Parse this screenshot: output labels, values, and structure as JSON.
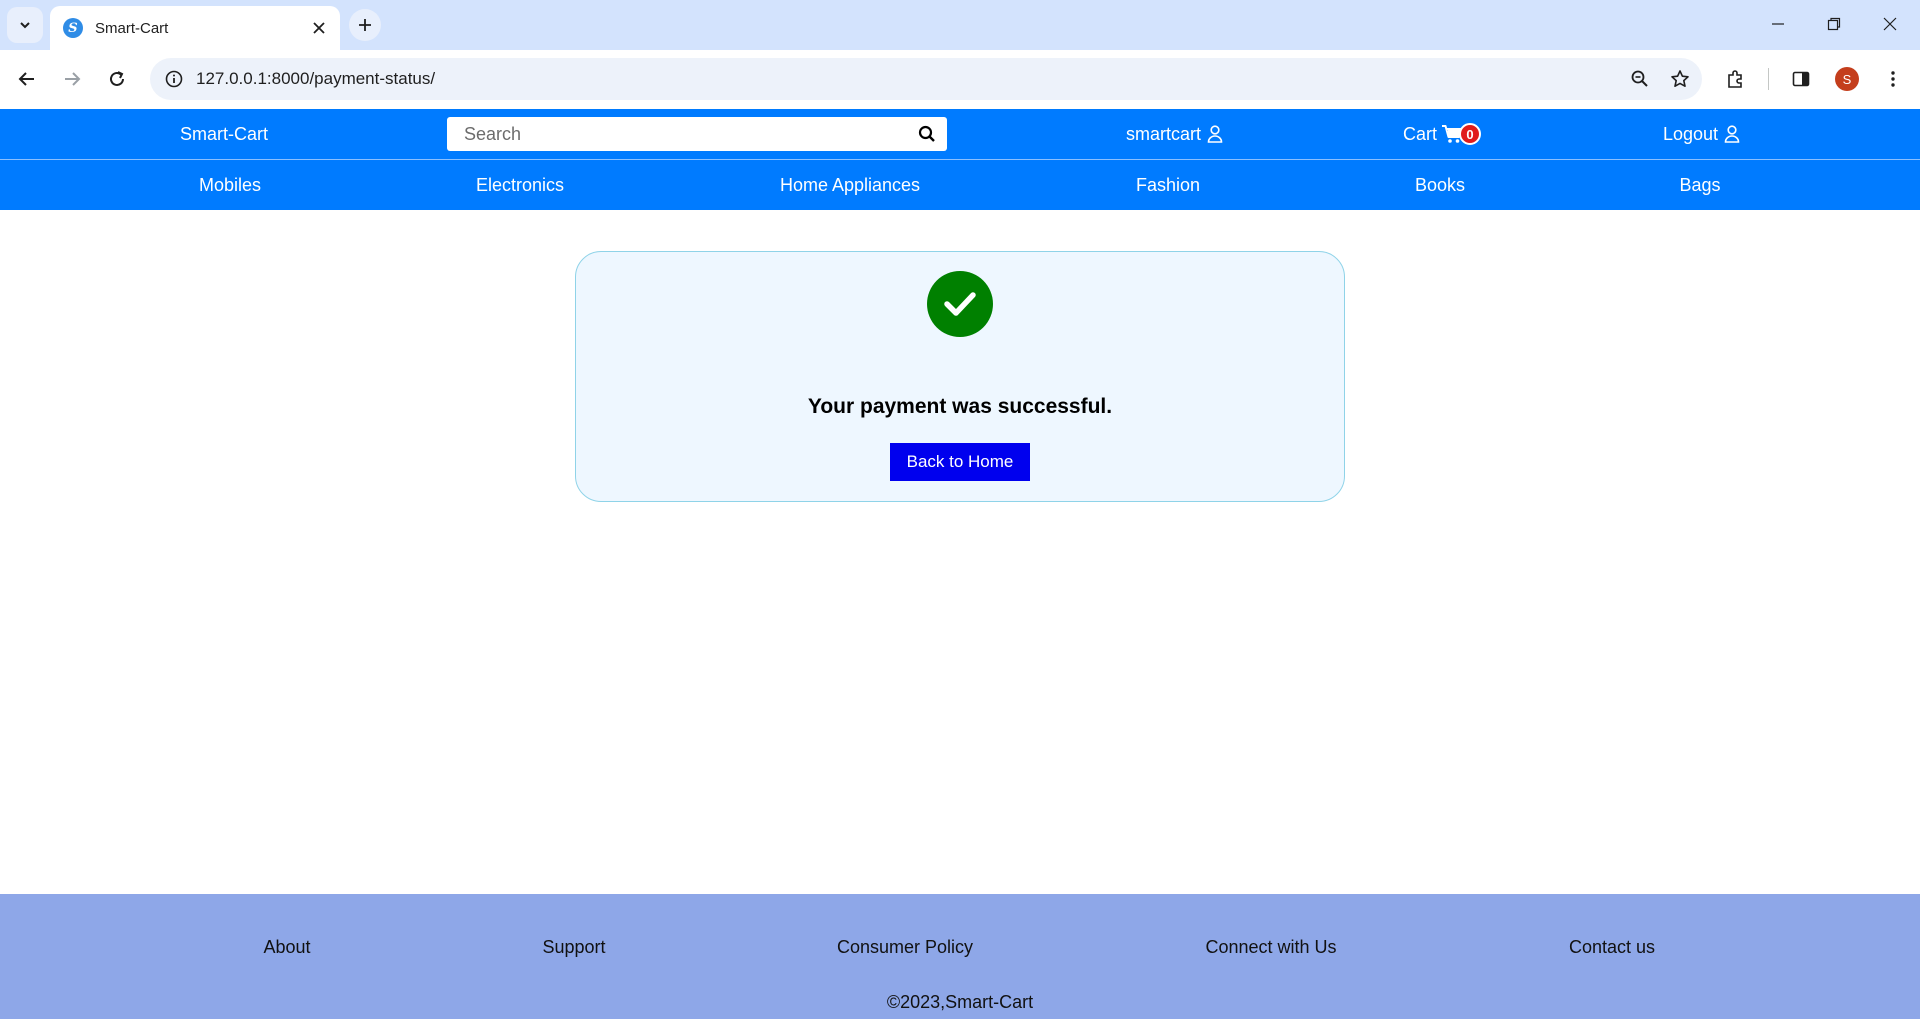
{
  "browser": {
    "tab_title": "Smart-Cart",
    "favicon_letter": "S",
    "url": "127.0.0.1:8000/payment-status/",
    "profile_initial": "S"
  },
  "header": {
    "brand": "Smart-Cart",
    "search_placeholder": "Search",
    "username": "smartcart",
    "cart_label": "Cart",
    "cart_count": "0",
    "logout_label": "Logout"
  },
  "categories": [
    "Mobiles",
    "Electronics",
    "Home Appliances",
    "Fashion",
    "Books",
    "Bags"
  ],
  "status": {
    "message": "Your payment was successful.",
    "button_label": "Back to Home",
    "success_color": "#008000"
  },
  "footer": {
    "links": [
      "About",
      "Support",
      "Consumer Policy",
      "Connect with Us",
      "Contact us"
    ],
    "copyright": "©2023,Smart-Cart"
  },
  "colors": {
    "header_bg": "#007bff",
    "footer_bg": "#8ea7e8",
    "button_bg": "#0000ee",
    "badge_bg": "#e01c1c"
  }
}
